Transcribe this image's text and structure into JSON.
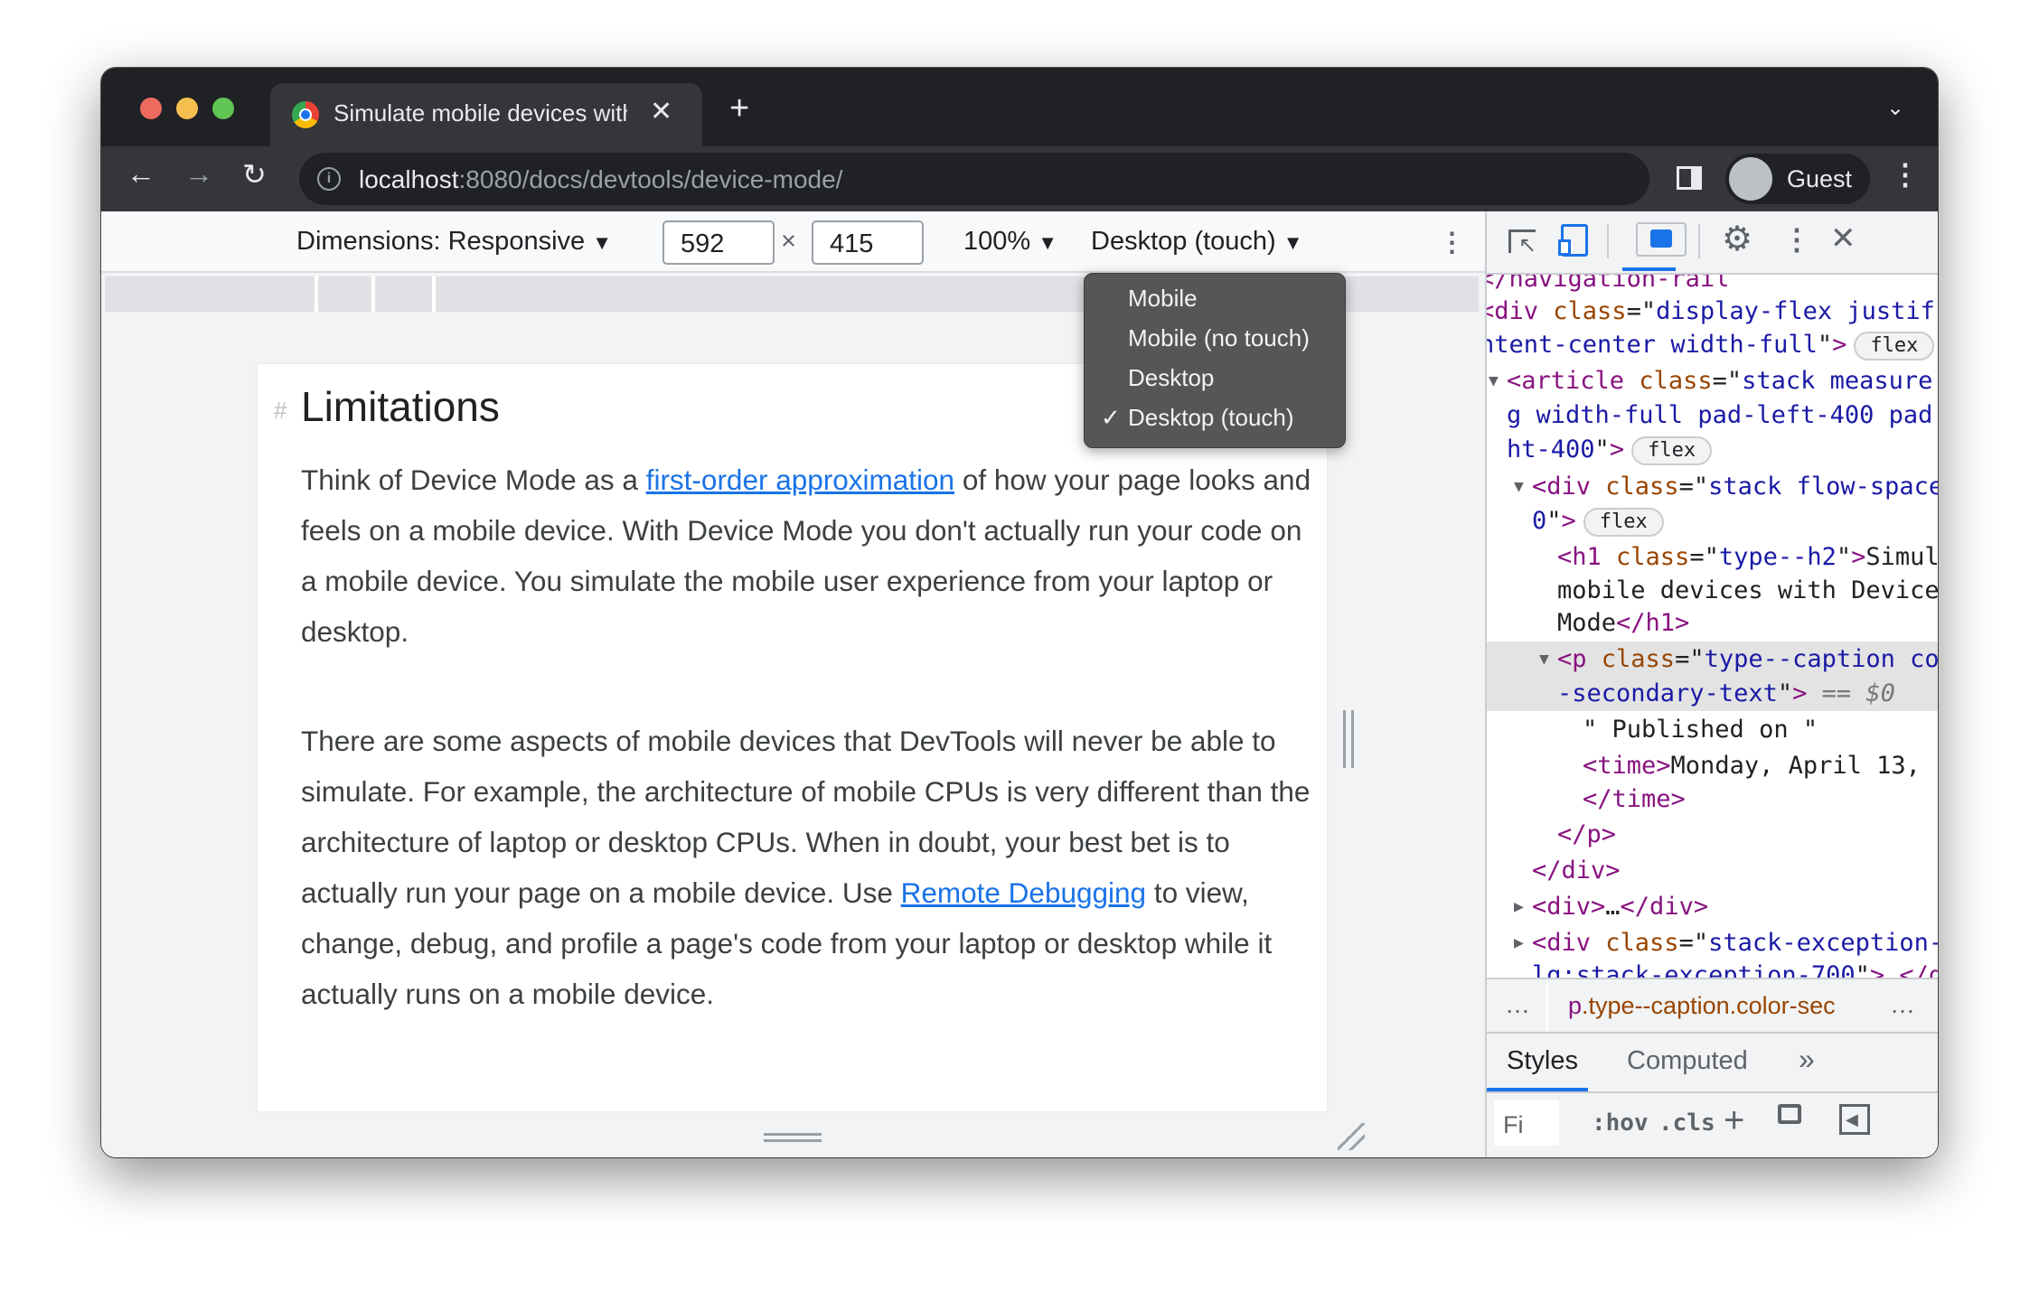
{
  "browser": {
    "tab_title": "Simulate mobile devices with DevTools",
    "url_host": "localhost",
    "url_path": ":8080/docs/devtools/device-mode/",
    "profile": "Guest",
    "colors": {
      "close": "#ed6a5e",
      "minimize": "#f5bf4f",
      "maximize": "#61c554"
    }
  },
  "device_toolbar": {
    "dimensions_label": "Dimensions: Responsive",
    "width": "592",
    "times": "×",
    "height": "415",
    "zoom": "100%",
    "device_type": "Desktop (touch)"
  },
  "device_type_menu": {
    "items": [
      {
        "label": "Mobile",
        "checked": false
      },
      {
        "label": "Mobile (no touch)",
        "checked": false
      },
      {
        "label": "Desktop",
        "checked": false
      },
      {
        "label": "Desktop (touch)",
        "checked": true
      }
    ],
    "check": "✓"
  },
  "page": {
    "anchor": "#",
    "heading": "Limitations",
    "p1_before": "Think of Device Mode as a ",
    "p1_link": "first-order approximation",
    "p1_after": " of how your page looks and feels on a mobile device. With Device Mode you don't actually run your code on a mobile device. You simulate the mobile user experience from your laptop or desktop.",
    "p2_before": "There are some aspects of mobile devices that DevTools will never be able to simulate. For example, the architecture of mobile CPUs is very different than the architecture of laptop or desktop CPUs. When in doubt, your best bet is to actually run your page on a mobile device. Use ",
    "p2_link": "Remote Debugging",
    "p2_after": " to view, change, debug, and profile a page's code from your laptop or desktop while it actually runs on a mobile device."
  },
  "devtools": {
    "elements": [
      {
        "indent": 0,
        "arrow": "",
        "segs": [
          [
            "tg",
            "<"
          ],
          [
            "tg",
            "/navigation-rail"
          ]
        ]
      },
      {
        "indent": 0,
        "arrow": "",
        "segs": [
          [
            "tg",
            "<div "
          ],
          [
            "an",
            "class"
          ],
          [
            "tx",
            "=\""
          ],
          [
            "av",
            "display-flex justif"
          ]
        ]
      },
      {
        "indent": 0,
        "arrow": "",
        "segs": [
          [
            "av",
            "ntent-center width-full"
          ],
          [
            "tx",
            "\""
          ],
          [
            "tg",
            ">"
          ]
        ],
        "badge": "flex"
      },
      {
        "indent": 0,
        "arrow": "▼",
        "segs": [
          [
            "tg",
            "<article "
          ],
          [
            "an",
            "class"
          ],
          [
            "tx",
            "=\""
          ],
          [
            "av",
            "stack measure"
          ]
        ]
      },
      {
        "indent": 0,
        "arrow": "",
        "segs": [
          [
            "av",
            "g width-full pad-left-400 pad"
          ]
        ]
      },
      {
        "indent": 0,
        "arrow": "",
        "segs": [
          [
            "av",
            "ht-400"
          ],
          [
            "tx",
            "\""
          ],
          [
            "tg",
            ">"
          ]
        ],
        "badge": "flex"
      },
      {
        "indent": 1,
        "arrow": "▼",
        "segs": [
          [
            "tg",
            "<div "
          ],
          [
            "an",
            "class"
          ],
          [
            "tx",
            "=\""
          ],
          [
            "av",
            "stack flow-space"
          ]
        ]
      },
      {
        "indent": 1,
        "arrow": "",
        "segs": [
          [
            "av",
            "0"
          ],
          [
            "tx",
            "\""
          ],
          [
            "tg",
            ">"
          ]
        ],
        "badge": "flex"
      },
      {
        "indent": 2,
        "arrow": "",
        "segs": [
          [
            "tg",
            "<h1 "
          ],
          [
            "an",
            "class"
          ],
          [
            "tx",
            "=\""
          ],
          [
            "av",
            "type--h2"
          ],
          [
            "tx",
            "\""
          ],
          [
            "tg",
            ">"
          ],
          [
            "tx",
            "Simulate"
          ]
        ]
      },
      {
        "indent": 2,
        "arrow": "",
        "segs": [
          [
            "tx",
            "mobile devices with Device"
          ]
        ]
      },
      {
        "indent": 2,
        "arrow": "",
        "segs": [
          [
            "tx",
            "Mode"
          ],
          [
            "tg",
            "</h1>"
          ]
        ]
      },
      {
        "indent": 2,
        "arrow": "▼",
        "selected": true,
        "segs": [
          [
            "tg",
            "<p "
          ],
          [
            "an",
            "class"
          ],
          [
            "tx",
            "=\""
          ],
          [
            "av",
            "type--caption color"
          ]
        ]
      },
      {
        "indent": 2,
        "arrow": "",
        "selected": true,
        "segs": [
          [
            "av",
            "-secondary-text"
          ],
          [
            "tx",
            "\""
          ],
          [
            "tg",
            ">"
          ],
          [
            "gr",
            " == $0"
          ]
        ]
      },
      {
        "indent": 3,
        "arrow": "",
        "segs": [
          [
            "tx",
            "\" Published on \""
          ]
        ]
      },
      {
        "indent": 3,
        "arrow": "",
        "segs": [
          [
            "tg",
            "<time>"
          ],
          [
            "tx",
            "Monday, April 13,"
          ]
        ]
      },
      {
        "indent": 3,
        "arrow": "",
        "segs": [
          [
            "tg",
            "</time>"
          ]
        ]
      },
      {
        "indent": 2,
        "arrow": "",
        "segs": [
          [
            "tg",
            "</p>"
          ]
        ]
      },
      {
        "indent": 1,
        "arrow": "",
        "segs": [
          [
            "tg",
            "</div>"
          ]
        ]
      },
      {
        "indent": 1,
        "arrow": "▶",
        "segs": [
          [
            "tg",
            "<div>"
          ],
          [
            "tx",
            "…"
          ],
          [
            "tg",
            "</div>"
          ]
        ]
      },
      {
        "indent": 1,
        "arrow": "▶",
        "segs": [
          [
            "tg",
            "<div "
          ],
          [
            "an",
            "class"
          ],
          [
            "tx",
            "=\""
          ],
          [
            "av",
            "stack-exception-"
          ]
        ]
      },
      {
        "indent": 1,
        "arrow": "",
        "segs": [
          [
            "av",
            "lg:stack-exception-700"
          ],
          [
            "tx",
            "\""
          ],
          [
            "tg",
            ">…</div>"
          ]
        ]
      }
    ],
    "breadcrumb_more": "…",
    "breadcrumb_tag": "p",
    "breadcrumb_class": ".type--caption.color-sec",
    "breadcrumb_more_right": "…",
    "tabs": [
      "Styles",
      "Computed"
    ],
    "tabs_overflow": "»",
    "filter_placeholder": "Fi",
    "hov": ":hov",
    "cls": ".cls",
    "accent": "#1a73e8"
  }
}
